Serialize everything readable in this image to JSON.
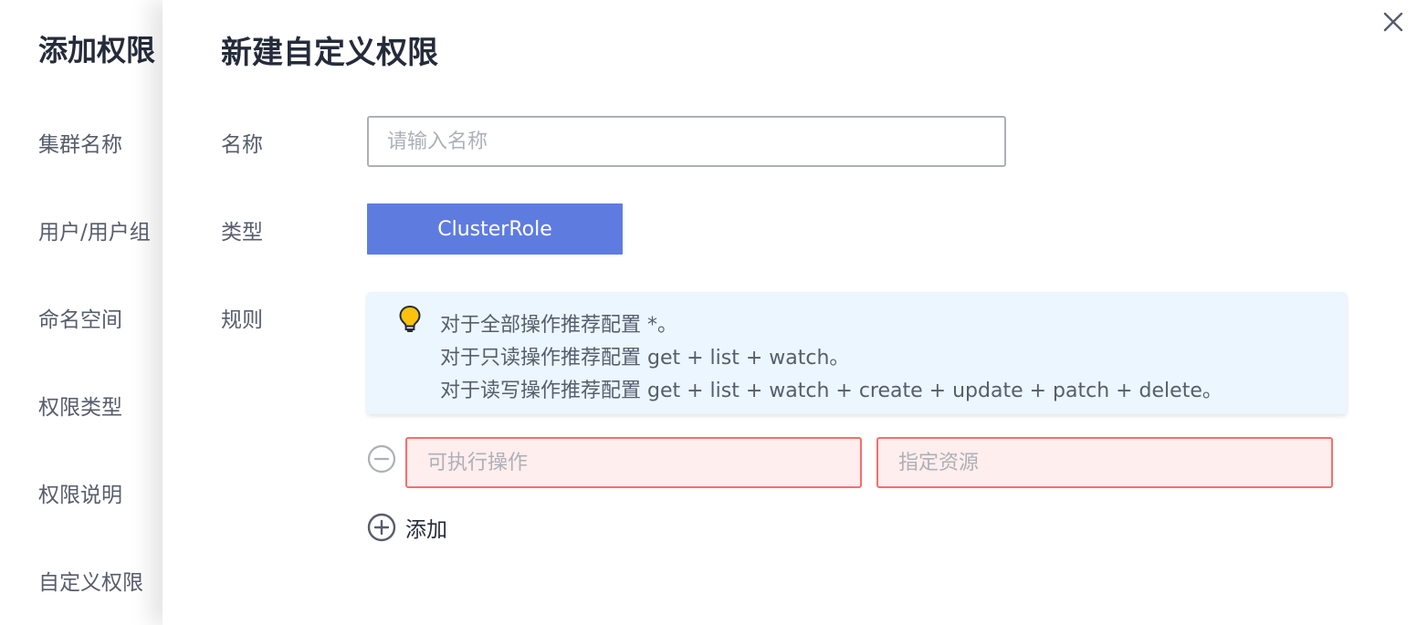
{
  "background_form": {
    "title": "添加权限",
    "fields": [
      {
        "label": "集群名称"
      },
      {
        "label": "用户/用户组"
      },
      {
        "label": "命名空间"
      },
      {
        "label": "权限类型"
      },
      {
        "label": "权限说明"
      },
      {
        "label": "自定义权限"
      }
    ]
  },
  "drawer": {
    "title": "新建自定义权限",
    "name": {
      "label": "名称",
      "placeholder": "请输入名称",
      "value": ""
    },
    "type": {
      "label": "类型",
      "selected": "ClusterRole"
    },
    "rules": {
      "label": "规则",
      "tips": [
        "对于全部操作推荐配置 *。",
        "对于只读操作推荐配置 get + list + watch。",
        "对于读写操作推荐配置 get + list + watch + create + update + patch + delete。"
      ],
      "rows": [
        {
          "verbs_placeholder": "可执行操作",
          "resources_placeholder": "指定资源"
        }
      ],
      "add_label": "添加"
    }
  },
  "colors": {
    "primary": "#5e7ce0",
    "tip_background": "#ebf6ff",
    "error_border": "#f66f6a",
    "error_background": "#ffeeed",
    "text_primary": "#252b3a",
    "text_secondary": "#575d6c",
    "placeholder": "#adb0b8"
  },
  "icons": {
    "close": "close-icon",
    "tip": "lightbulb-icon",
    "remove": "minus-circle-icon",
    "add": "plus-circle-icon"
  }
}
